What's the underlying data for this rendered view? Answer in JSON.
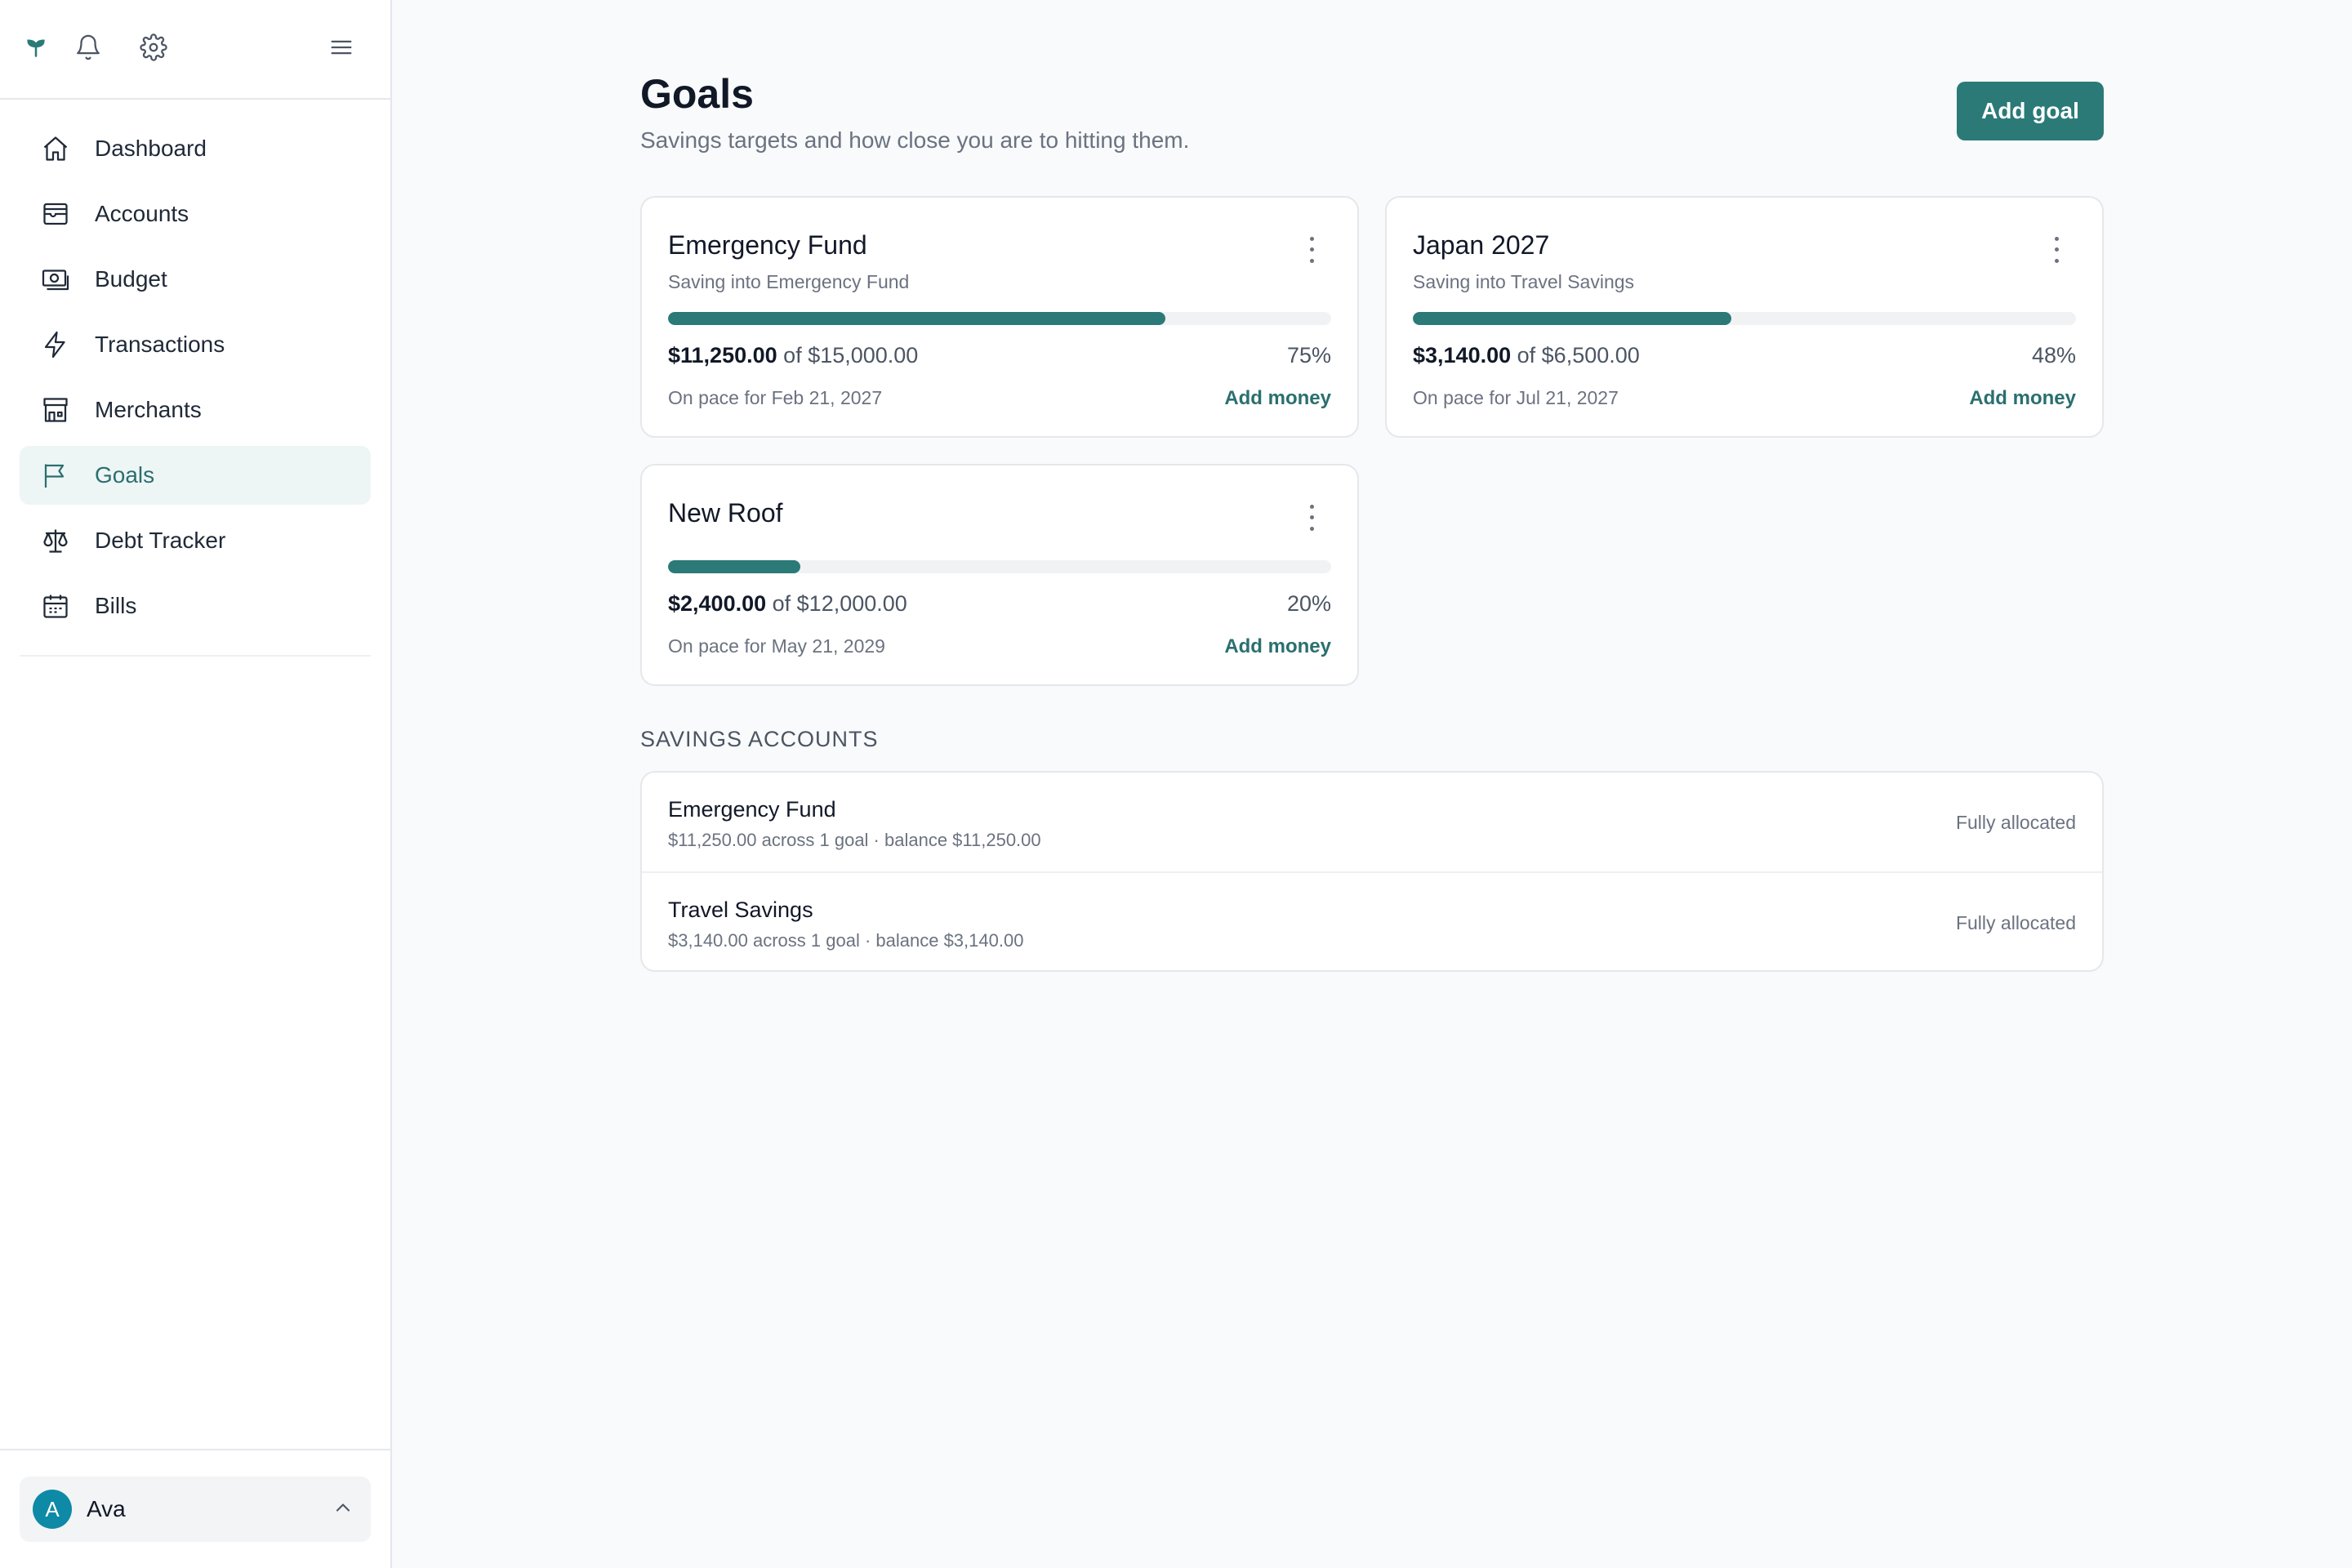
{
  "sidebar": {
    "top_icons": [
      "logo-sprout-icon",
      "bell-icon",
      "gear-icon",
      "menu-icon"
    ],
    "items": [
      {
        "label": "Dashboard",
        "icon": "home-icon"
      },
      {
        "label": "Accounts",
        "icon": "wallet-icon"
      },
      {
        "label": "Budget",
        "icon": "money-icon"
      },
      {
        "label": "Transactions",
        "icon": "lightning-icon"
      },
      {
        "label": "Merchants",
        "icon": "store-icon"
      },
      {
        "label": "Goals",
        "icon": "flag-icon",
        "active": true
      },
      {
        "label": "Debt Tracker",
        "icon": "scale-icon"
      },
      {
        "label": "Bills",
        "icon": "calendar-icon"
      }
    ],
    "user": {
      "initial": "A",
      "name": "Ava"
    }
  },
  "header": {
    "title": "Goals",
    "subtitle": "Savings targets and how close you are to hitting them.",
    "add_goal_label": "Add goal"
  },
  "goals": [
    {
      "name": "Emergency Fund",
      "subtitle": "Saving into Emergency Fund",
      "saved": "$11,250.00",
      "of_target": "of $15,000.00",
      "percent_label": "75%",
      "progress": 0.75,
      "pace": "On pace for Feb 21, 2027",
      "action": "Add money"
    },
    {
      "name": "Japan 2027",
      "subtitle": "Saving into Travel Savings",
      "saved": "$3,140.00",
      "of_target": "of $6,500.00",
      "percent_label": "48%",
      "progress": 0.48,
      "pace": "On pace for Jul 21, 2027",
      "action": "Add money"
    },
    {
      "name": "New Roof",
      "saved": "$2,400.00",
      "of_target": "of $12,000.00",
      "percent_label": "20%",
      "progress": 0.2,
      "pace": "On pace for May 21, 2029",
      "action": "Add money"
    }
  ],
  "savings_accounts": {
    "heading": "SAVINGS ACCOUNTS",
    "rows": [
      {
        "name": "Emergency Fund",
        "detail": "$11,250.00 across 1 goal · balance $11,250.00",
        "status": "Fully allocated"
      },
      {
        "name": "Travel Savings",
        "detail": "$3,140.00 across 1 goal · balance $3,140.00",
        "status": "Fully allocated"
      }
    ]
  },
  "colors": {
    "accent": "#2b7a78",
    "active_bg": "#eef5f5",
    "avatar": "#0e8aa6"
  }
}
